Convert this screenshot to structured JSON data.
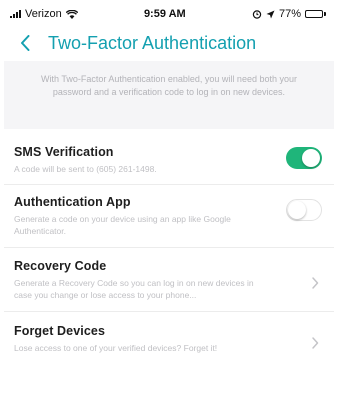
{
  "status_bar": {
    "carrier": "Verizon",
    "time": "9:59 AM",
    "battery": "77%",
    "battery_level": 0.77
  },
  "nav": {
    "title": "Two-Factor Authentication"
  },
  "info": {
    "text": "With Two-Factor Authentication enabled, you will need both your password and a verification code to log in on new devices."
  },
  "settings": [
    {
      "title": "SMS Verification",
      "description": "A code will be sent to (605) 261-1498.",
      "control": "toggle",
      "enabled": true
    },
    {
      "title": "Authentication App",
      "description": "Generate a code on your device using an app like Google Authenticator.",
      "control": "toggle",
      "enabled": false
    },
    {
      "title": "Recovery Code",
      "description": "Generate a Recovery Code so you can log in on new devices in case you change or lose access to your phone...",
      "control": "chevron"
    },
    {
      "title": "Forget Devices",
      "description": "Lose access to one of your verified devices? Forget it!",
      "control": "chevron"
    }
  ],
  "colors": {
    "accent": "#14a0b0",
    "toggle_on": "#1fb57a",
    "banner_bg": "#f5f5f7"
  },
  "icons": [
    "signal-icon",
    "wifi-icon",
    "location-icon",
    "alarm-icon",
    "battery-icon",
    "back-chevron-icon",
    "chevron-right-icon"
  ]
}
